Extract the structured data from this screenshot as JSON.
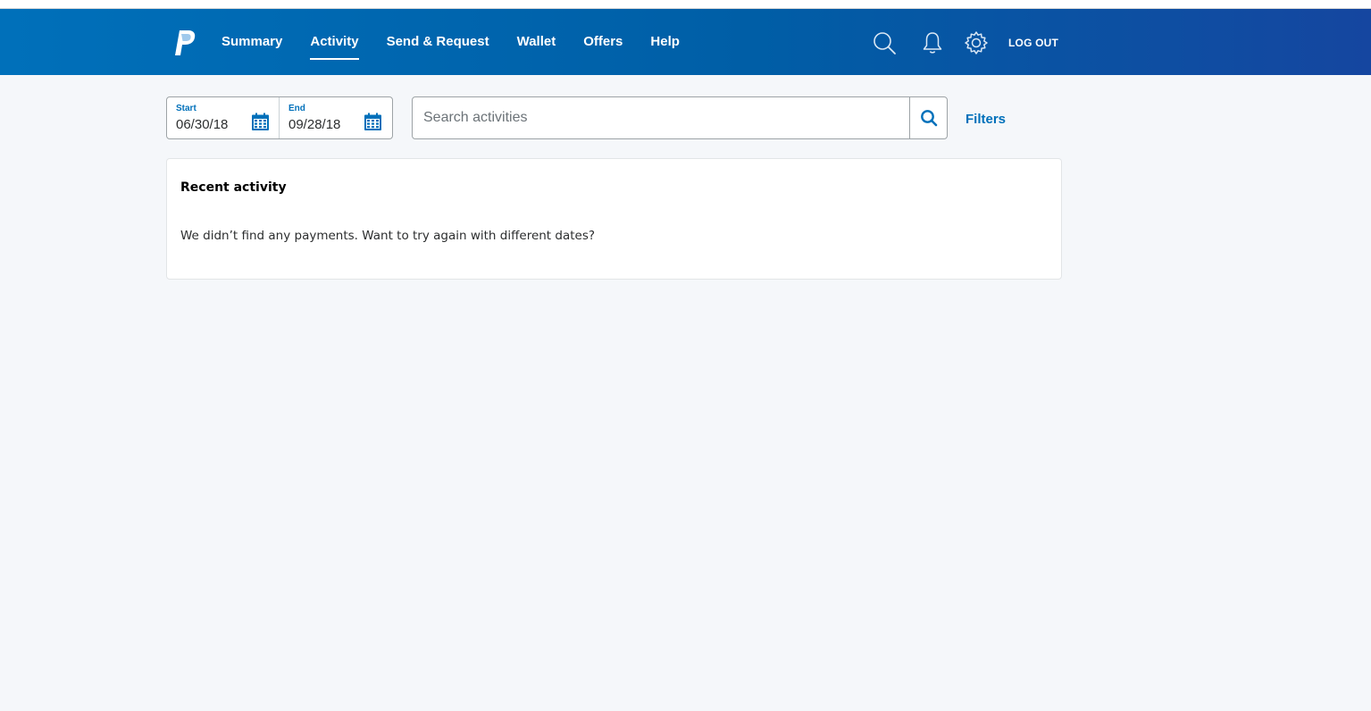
{
  "nav": {
    "items": [
      {
        "label": "Summary"
      },
      {
        "label": "Activity",
        "active": true
      },
      {
        "label": "Send & Request"
      },
      {
        "label": "Wallet"
      },
      {
        "label": "Offers"
      },
      {
        "label": "Help"
      }
    ],
    "icons": [
      "search-icon",
      "bell-icon",
      "gear-icon"
    ],
    "logout_label": "LOG OUT"
  },
  "date_range": {
    "start_label": "Start",
    "start_value": "06/30/18",
    "end_label": "End",
    "end_value": "09/28/18"
  },
  "search": {
    "placeholder": "Search activities",
    "value": ""
  },
  "filters_label": "Filters",
  "recent": {
    "title": "Recent activity",
    "message": "We didn’t find any payments. Want to try again with different dates?"
  },
  "colors": {
    "header_start": "#0070ba",
    "header_end": "#1546a0",
    "accent": "#0070ba",
    "background": "#f5f7fa"
  }
}
